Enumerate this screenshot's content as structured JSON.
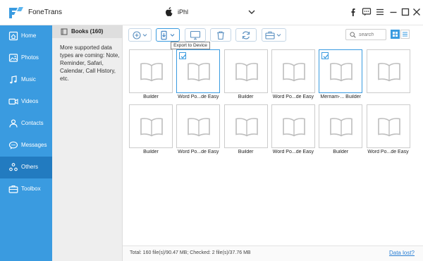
{
  "app": {
    "title": "FoneTrans",
    "device": "iPhl"
  },
  "sidebar": {
    "items": [
      {
        "label": "Home",
        "icon": "home-icon"
      },
      {
        "label": "Photos",
        "icon": "photos-icon"
      },
      {
        "label": "Music",
        "icon": "music-icon"
      },
      {
        "label": "Videos",
        "icon": "videos-icon"
      },
      {
        "label": "Contacts",
        "icon": "contacts-icon"
      },
      {
        "label": "Messages",
        "icon": "messages-icon"
      },
      {
        "label": "Others",
        "icon": "others-icon",
        "active": true
      },
      {
        "label": "Toolbox",
        "icon": "toolbox-icon"
      }
    ]
  },
  "category": {
    "label": "Books (160)",
    "note": "More supported data types are coming: Note, Reminder, Safari, Calendar, Call History, etc."
  },
  "toolbar": {
    "tooltip": "Export to Device",
    "search_placeholder": "search"
  },
  "books": [
    {
      "title": "Builder",
      "checked": false
    },
    {
      "title": "Word Po...de Easy",
      "checked": true
    },
    {
      "title": "Builder",
      "checked": false
    },
    {
      "title": "Word Po...de Easy",
      "checked": false
    },
    {
      "title": "Merriam-... Builder",
      "checked": true
    },
    {
      "title": "",
      "checked": false
    },
    {
      "title": "Builder",
      "checked": false
    },
    {
      "title": "Word Po...de Easy",
      "checked": false
    },
    {
      "title": "Builder",
      "checked": false
    },
    {
      "title": "Word Po...de Easy",
      "checked": false
    },
    {
      "title": "Builder",
      "checked": false
    },
    {
      "title": "Word Po...de Easy",
      "checked": false
    }
  ],
  "status": {
    "summary": "Total: 160 file(s)/90.47 MB; Checked: 2 file(s)/37.76 MB",
    "data_lost_link": "Data lost?"
  },
  "colors": {
    "sidebar": "#3a9be0",
    "sidebar_active": "#227bc0",
    "accent": "#3a9be0"
  }
}
